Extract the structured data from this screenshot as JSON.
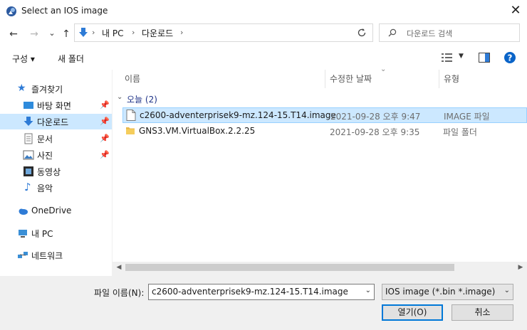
{
  "window": {
    "title": "Select an IOS image",
    "close_glyph": "✕"
  },
  "nav": {
    "back": "←",
    "forward": "→",
    "recent": "⌄",
    "up": "↑",
    "breadcrumb": [
      "내 PC",
      "다운로드"
    ],
    "search_placeholder": "다운로드 검색"
  },
  "toolbar": {
    "organize": "구성 ▾",
    "new_folder": "새 폴더"
  },
  "sidebar": {
    "quick_access": "즐겨찾기",
    "items": [
      {
        "label": "바탕 화면",
        "icon": "desktop-icon",
        "pinned": true
      },
      {
        "label": "다운로드",
        "icon": "download-icon",
        "pinned": true
      },
      {
        "label": "문서",
        "icon": "document-icon",
        "pinned": true
      },
      {
        "label": "사진",
        "icon": "picture-icon",
        "pinned": true
      },
      {
        "label": "동영상",
        "icon": "video-icon",
        "pinned": false
      },
      {
        "label": "음악",
        "icon": "music-icon",
        "pinned": false
      }
    ],
    "onedrive": "OneDrive",
    "this_pc": "내 PC",
    "network": "네트워크"
  },
  "columns": {
    "name": "이름",
    "modified": "수정한 날짜",
    "type": "유형"
  },
  "group": {
    "label": "오늘 (2)"
  },
  "files": [
    {
      "name": "c2600-adventerprisek9-mz.124-15.T14.image",
      "modified": "2021-09-28 오후 9:47",
      "type": "IMAGE 파일",
      "icon": "file-icon"
    },
    {
      "name": "GNS3.VM.VirtualBox.2.2.25",
      "modified": "2021-09-28 오후 9:35",
      "type": "파일 폴더",
      "icon": "folder-icon"
    }
  ],
  "footer": {
    "filename_label": "파일 이름(N):",
    "filename_value": "c2600-adventerprisek9-mz.124-15.T14.image",
    "filetype_value": "IOS image (*.bin *.image)",
    "open": "열기(O)",
    "cancel": "취소"
  },
  "colors": {
    "accent": "#0078d7",
    "selection": "#cce8ff",
    "folder": "#e8b84b"
  }
}
